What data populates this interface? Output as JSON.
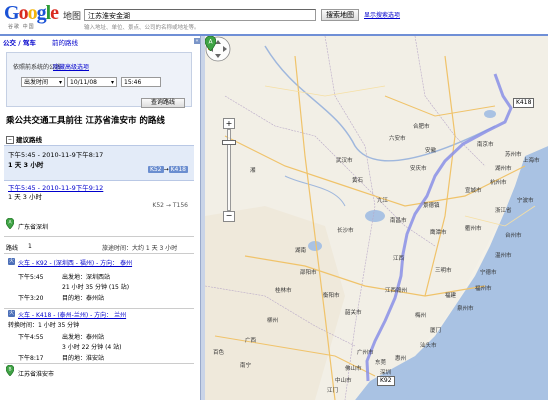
{
  "header": {
    "logo": {
      "g1": "G",
      "o1": "o",
      "o2": "o",
      "g2": "g",
      "l": "l",
      "e": "e",
      "sub": "谷歌 中国"
    },
    "app_name": "地图",
    "search_value": "江苏淮安金湖",
    "search_button": "搜索地图",
    "search_options": "显示搜索选项",
    "search_hint": "输入地址、单位、景点、公司的名称或地址等。"
  },
  "tabs": {
    "transit_drive": "公交 / 驾车",
    "previous": "前的路线"
  },
  "form": {
    "route_label": "依照前系统的公线",
    "route_link": "隐藏高级选项",
    "depart_select": "出发时间",
    "date": "10/11/08",
    "time": "15:46",
    "search_route_button": "查询路线"
  },
  "result_title": "乘公共交通工具前往 江苏省淮安市 的路线",
  "suggest_header": "建议路线",
  "options": [
    {
      "time": "下午5:45 - 2010-11-9下午8:17",
      "duration": "1 天 3 小时",
      "line1": "K52",
      "arrow": "→",
      "line2": "K418"
    },
    {
      "time": "下午5:45 - 2010-11-9下午9:12",
      "duration": "1 天 3 小时",
      "line1": "K52",
      "arrow": "→",
      "line2": "T156"
    }
  ],
  "origin": "广东省深圳",
  "route_row": {
    "label": "路线",
    "num": "1",
    "total": "旅途时间：大约 1 天 3 小时"
  },
  "steps": [
    {
      "icon": "火",
      "head": "火车 - K92 - (深圳西 - 福州) - 方向： 泰州",
      "dep_time": "下午5:45",
      "dep": "出发地：深圳西站",
      "dur": "21 小时 35 分钟 (15 站)",
      "arr_time": "下午3:20",
      "arr": "目的地：泰州站"
    },
    {
      "icon": "火",
      "head": "火车 - K418 - (泰州-兰州) - 方向： 兰州",
      "transfer": "转换时间：1 小时 35 分钟",
      "dep_time": "下午4:55",
      "dep": "出发地：泰州站",
      "dur": "3 小时 22 分钟 (4 站)",
      "arr_time": "下午8:17",
      "arr": "目的地：淮安站"
    }
  ],
  "destination": "江苏省淮安市",
  "map": {
    "marker_b": "B",
    "marker_a": "A",
    "tag_k418": "K418",
    "tag_k92": "K92",
    "cities": [
      "南京市",
      "合肥市",
      "六安市",
      "宣城市",
      "苏州市",
      "上海市",
      "武汉市",
      "安庆市",
      "杭州市",
      "黄石",
      "湖州市",
      "安徽",
      "宁波市",
      "湘",
      "浙江省",
      "九江",
      "景德镇",
      "衢州市",
      "台州市",
      "南昌市",
      "鹰潭市",
      "长沙市",
      "温州市",
      "江西",
      "宁德市",
      "湖南",
      "三明市",
      "福州市",
      "福建",
      "泉州市",
      "厦门",
      "江西赣州",
      "广西",
      "广州市",
      "惠州",
      "深圳",
      "桂林市",
      "韶关市",
      "梅州",
      "邵阳市",
      "衡阳市",
      "柳州",
      "汕头市",
      "东莞",
      "中山市",
      "南宁",
      "百色",
      "江门",
      "佛山市"
    ],
    "zoom_plus": "+",
    "zoom_minus": "−"
  },
  "colors": {
    "route": "#8a8fe6",
    "header_rule": "#6f8fd6",
    "option_bg": "#e3ebf8"
  }
}
